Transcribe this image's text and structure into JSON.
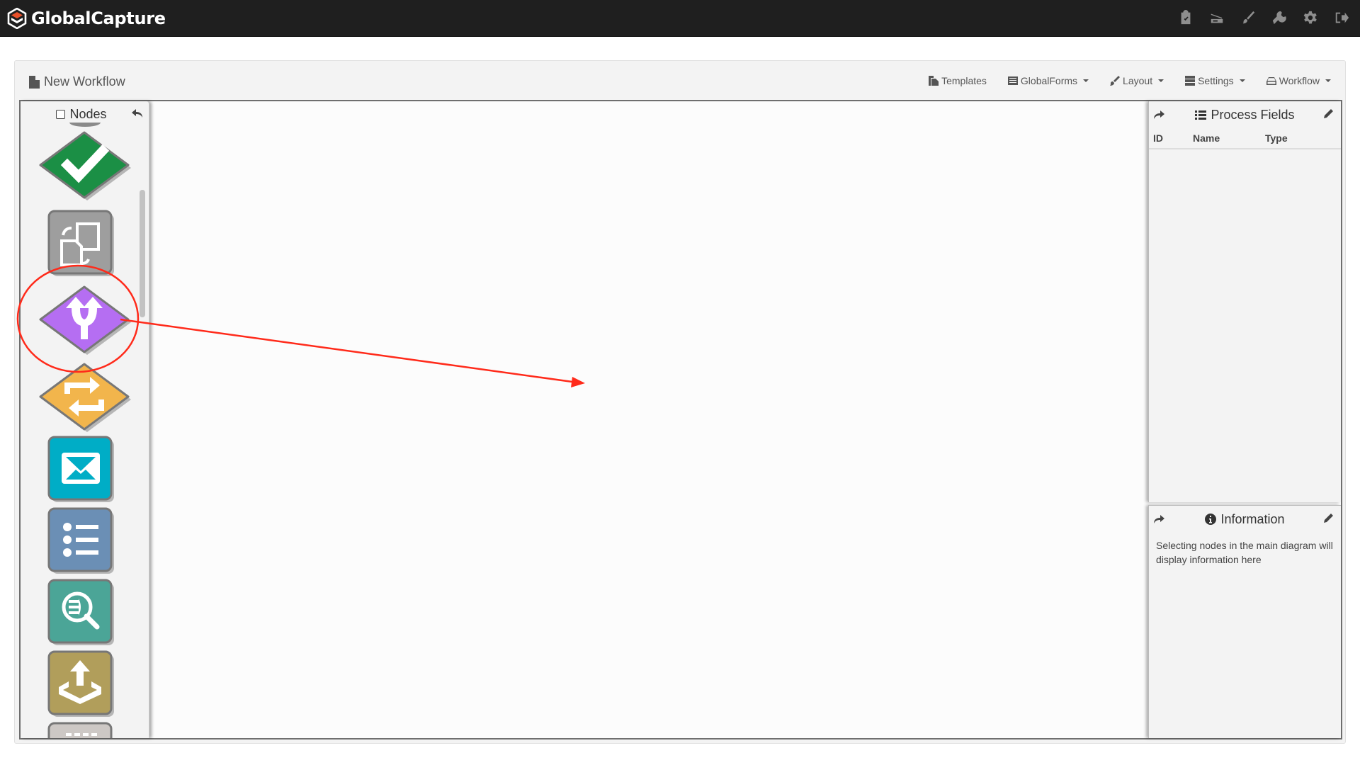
{
  "app": {
    "brand_name": "GlobalCapture",
    "brand_accent": "#e8502a",
    "nav_icons": [
      {
        "name": "tasks",
        "icon": "clipboard-check-icon"
      },
      {
        "name": "scan",
        "icon": "scanner-icon"
      },
      {
        "name": "design",
        "icon": "paintbrush-icon"
      },
      {
        "name": "tools",
        "icon": "wrench-icon"
      },
      {
        "name": "settings",
        "icon": "gear-icon"
      },
      {
        "name": "logout",
        "icon": "sign-out-icon"
      }
    ]
  },
  "header": {
    "title": "New Workflow",
    "toolbar": {
      "templates": "Templates",
      "globalforms": "GlobalForms",
      "layout": "Layout",
      "settings": "Settings",
      "workflow": "Workflow"
    }
  },
  "palette": {
    "title": "Nodes",
    "nodes": [
      {
        "type": "approve",
        "shape": "diamond",
        "color": "#1b8f45",
        "icon": "checkmark-icon"
      },
      {
        "type": "convert",
        "shape": "square",
        "color": "#9e9e9e",
        "icon": "document-convert-icon"
      },
      {
        "type": "split",
        "shape": "diamond",
        "color": "#b56ef2",
        "icon": "fork-icon"
      },
      {
        "type": "loop",
        "shape": "diamond",
        "color": "#f2b54c",
        "icon": "exchange-icon"
      },
      {
        "type": "email",
        "shape": "square",
        "color": "#00adc6",
        "icon": "envelope-icon"
      },
      {
        "type": "list",
        "shape": "square",
        "color": "#6b8fb5",
        "icon": "list-icon"
      },
      {
        "type": "lookup",
        "shape": "square",
        "color": "#4ba597",
        "icon": "search-data-icon"
      },
      {
        "type": "export",
        "shape": "square",
        "color": "#b19e5b",
        "icon": "export-icon"
      },
      {
        "type": "more",
        "shape": "square",
        "color": "#cdc8c5",
        "icon": "dashes-icon"
      }
    ]
  },
  "annotation": {
    "color": "#ff2a1a",
    "target_node": "split"
  },
  "process_fields": {
    "title": "Process Fields",
    "columns": [
      "ID",
      "Name",
      "Type"
    ],
    "rows": []
  },
  "information": {
    "title": "Information",
    "text": "Selecting nodes in the main diagram will display information here"
  }
}
